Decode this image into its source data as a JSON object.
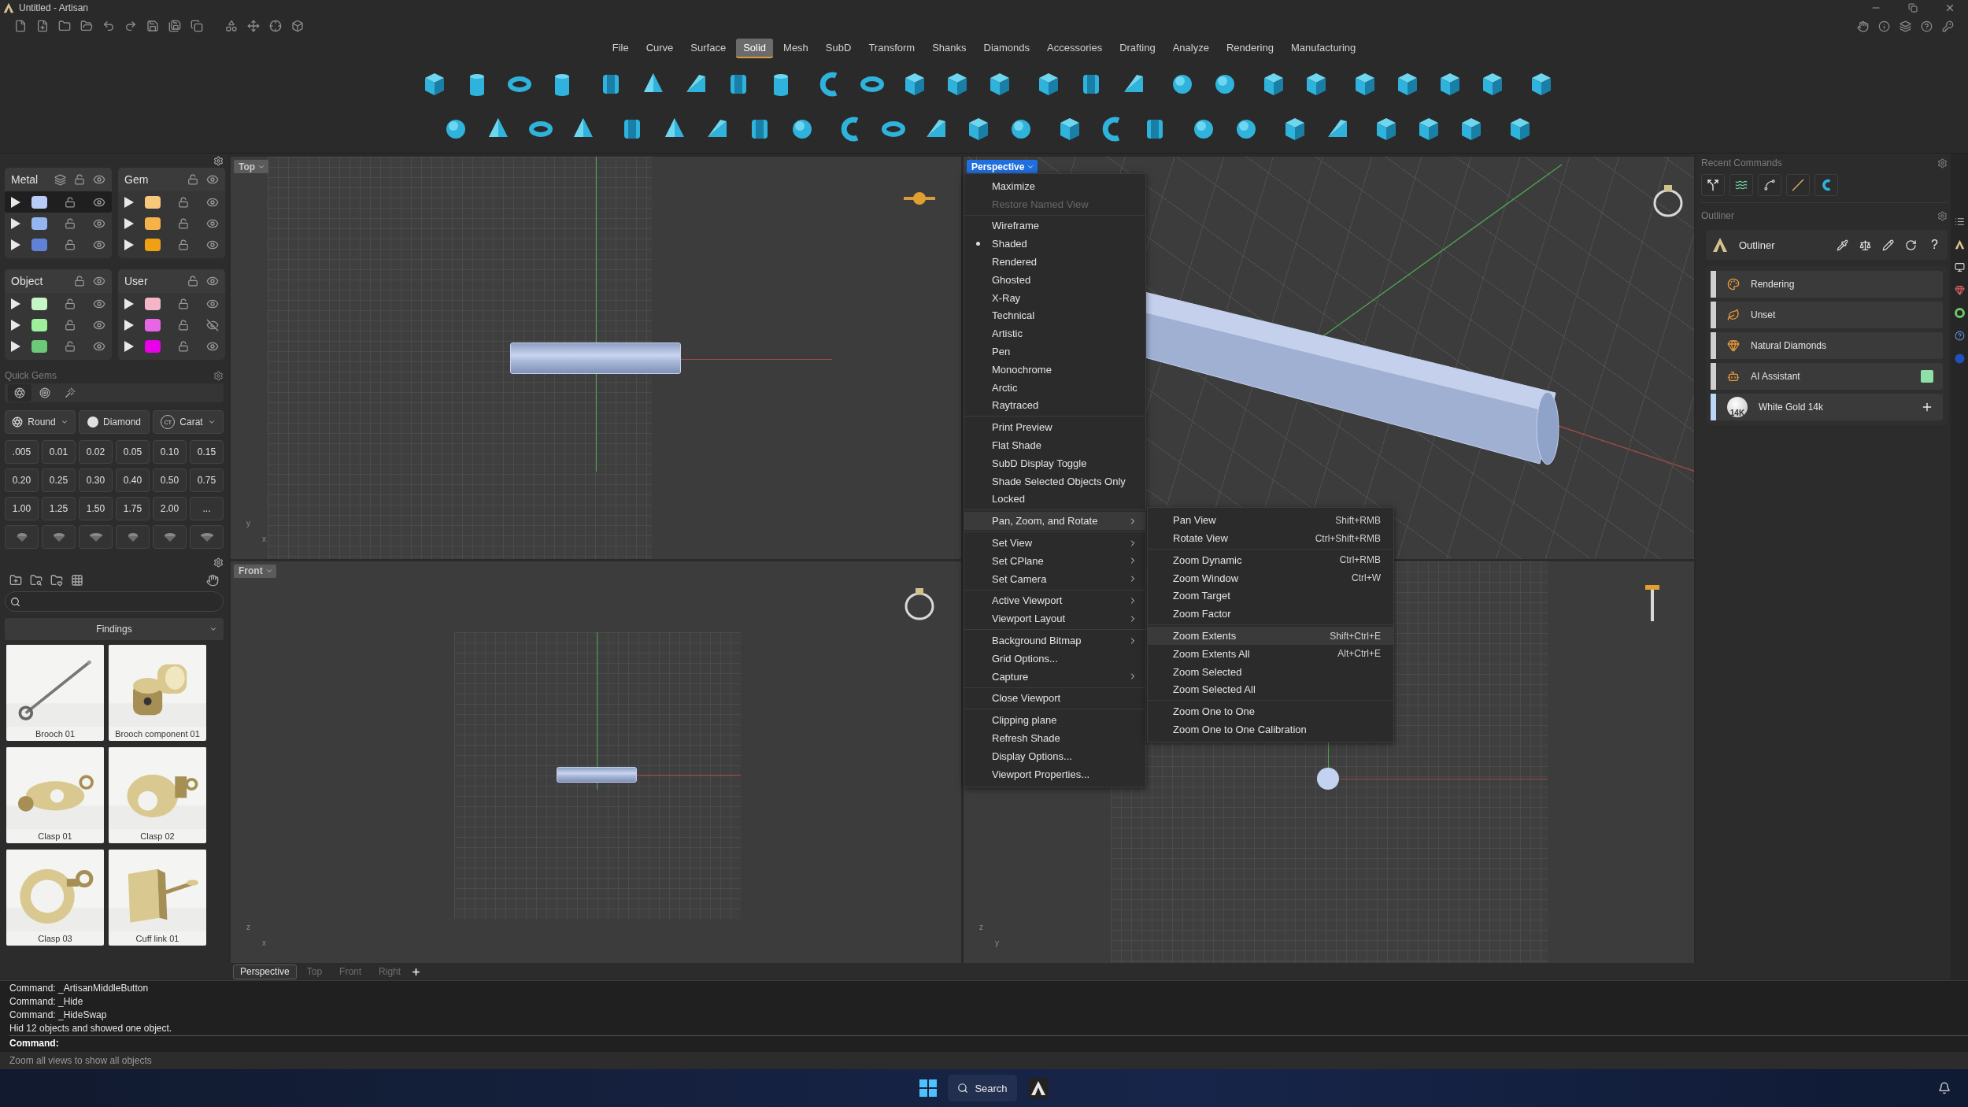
{
  "window": {
    "title": "Untitled - Artisan"
  },
  "menu_tabs": [
    {
      "label": "File",
      "selected": false
    },
    {
      "label": "Curve",
      "selected": false
    },
    {
      "label": "Surface",
      "selected": false
    },
    {
      "label": "Solid",
      "selected": true
    },
    {
      "label": "Mesh",
      "selected": false
    },
    {
      "label": "SubD",
      "selected": false
    },
    {
      "label": "Transform",
      "selected": false
    },
    {
      "label": "Shanks",
      "selected": false
    },
    {
      "label": "Diamonds",
      "selected": false
    },
    {
      "label": "Accessories",
      "selected": false
    },
    {
      "label": "Drafting",
      "selected": false
    },
    {
      "label": "Analyze",
      "selected": false
    },
    {
      "label": "Rendering",
      "selected": false
    },
    {
      "label": "Manufacturing",
      "selected": false
    }
  ],
  "layers": [
    {
      "name": "Metal",
      "material_toggle": true,
      "rows": [
        {
          "color": "#b9ccf7",
          "visible": true,
          "selected": true
        },
        {
          "color": "#94b6f0",
          "visible": true,
          "selected": false
        },
        {
          "color": "#5f82d6",
          "visible": true,
          "selected": false
        }
      ]
    },
    {
      "name": "Gem",
      "material_toggle": false,
      "rows": [
        {
          "color": "#f7c77a",
          "visible": true,
          "selected": false
        },
        {
          "color": "#f5b24a",
          "visible": true,
          "selected": false
        },
        {
          "color": "#f0a012",
          "visible": true,
          "selected": false
        }
      ]
    },
    {
      "name": "Object",
      "material_toggle": false,
      "rows": [
        {
          "color": "#c6f6c6",
          "visible": true,
          "selected": false
        },
        {
          "color": "#9ef09a",
          "visible": true,
          "selected": false
        },
        {
          "color": "#6cc978",
          "visible": true,
          "selected": false
        }
      ]
    },
    {
      "name": "User",
      "material_toggle": false,
      "rows": [
        {
          "color": "#f4b5c6",
          "visible": true,
          "selected": false
        },
        {
          "color": "#e866e6",
          "visible": false,
          "selected": false
        },
        {
          "color": "#e800e8",
          "visible": true,
          "selected": false
        }
      ]
    }
  ],
  "quick_gems": {
    "title": "Quick Gems",
    "shape": "Round",
    "material": "Diamond",
    "unit": "Carat",
    "unit_badge": "CT",
    "sizes": [
      ".005",
      "0.01",
      "0.02",
      "0.05",
      "0.10",
      "0.15",
      "0.20",
      "0.25",
      "0.30",
      "0.40",
      "0.50",
      "0.75",
      "1.00",
      "1.25",
      "1.50",
      "1.75",
      "2.00",
      "..."
    ]
  },
  "library": {
    "category": "Findings",
    "items": [
      {
        "label": "Brooch 01"
      },
      {
        "label": "Brooch component 01"
      },
      {
        "label": "Clasp 01"
      },
      {
        "label": "Clasp 02"
      },
      {
        "label": "Clasp 03"
      },
      {
        "label": "Cuff link 01"
      }
    ]
  },
  "viewports": {
    "top": {
      "label": "Top",
      "active": false,
      "axes": [
        "y",
        "x"
      ]
    },
    "perspective": {
      "label": "Perspective",
      "active": true
    },
    "front": {
      "label": "Front",
      "active": false,
      "axes": [
        "z",
        "x"
      ]
    },
    "right": {
      "axes": [
        "z",
        "y"
      ]
    }
  },
  "viewport_tabs": [
    {
      "label": "Perspective",
      "selected": true
    },
    {
      "label": "Top",
      "selected": false
    },
    {
      "label": "Front",
      "selected": false
    },
    {
      "label": "Right",
      "selected": false
    }
  ],
  "context_menu": {
    "sections": [
      [
        {
          "label": "Maximize",
          "disabled": false,
          "checked": false,
          "submenu": false,
          "selected": false
        },
        {
          "label": "Restore Named View",
          "disabled": true,
          "checked": false,
          "submenu": false,
          "selected": false
        }
      ],
      [
        {
          "label": "Wireframe",
          "disabled": false,
          "checked": false,
          "submenu": false,
          "selected": false
        },
        {
          "label": "Shaded",
          "disabled": false,
          "checked": true,
          "submenu": false,
          "selected": false
        },
        {
          "label": "Rendered",
          "disabled": false,
          "checked": false,
          "submenu": false,
          "selected": false
        },
        {
          "label": "Ghosted",
          "disabled": false,
          "checked": false,
          "submenu": false,
          "selected": false
        },
        {
          "label": "X-Ray",
          "disabled": false,
          "checked": false,
          "submenu": false,
          "selected": false
        },
        {
          "label": "Technical",
          "disabled": false,
          "checked": false,
          "submenu": false,
          "selected": false
        },
        {
          "label": "Artistic",
          "disabled": false,
          "checked": false,
          "submenu": false,
          "selected": false
        },
        {
          "label": "Pen",
          "disabled": false,
          "checked": false,
          "submenu": false,
          "selected": false
        },
        {
          "label": "Monochrome",
          "disabled": false,
          "checked": false,
          "submenu": false,
          "selected": false
        },
        {
          "label": "Arctic",
          "disabled": false,
          "checked": false,
          "submenu": false,
          "selected": false
        },
        {
          "label": "Raytraced",
          "disabled": false,
          "checked": false,
          "submenu": false,
          "selected": false
        }
      ],
      [
        {
          "label": "Print Preview",
          "disabled": false,
          "checked": false,
          "submenu": false,
          "selected": false
        },
        {
          "label": "Flat Shade",
          "disabled": false,
          "checked": false,
          "submenu": false,
          "selected": false
        },
        {
          "label": "SubD Display Toggle",
          "disabled": false,
          "checked": false,
          "submenu": false,
          "selected": false
        },
        {
          "label": "Shade Selected Objects Only",
          "disabled": false,
          "checked": false,
          "submenu": false,
          "selected": false
        },
        {
          "label": "Locked",
          "disabled": false,
          "checked": false,
          "submenu": false,
          "selected": false
        }
      ],
      [
        {
          "label": "Pan, Zoom, and Rotate",
          "disabled": false,
          "checked": false,
          "submenu": true,
          "selected": true
        }
      ],
      [
        {
          "label": "Set View",
          "disabled": false,
          "checked": false,
          "submenu": true,
          "selected": false
        },
        {
          "label": "Set CPlane",
          "disabled": false,
          "checked": false,
          "submenu": true,
          "selected": false
        },
        {
          "label": "Set Camera",
          "disabled": false,
          "checked": false,
          "submenu": true,
          "selected": false
        }
      ],
      [
        {
          "label": "Active Viewport",
          "disabled": false,
          "checked": false,
          "submenu": true,
          "selected": false
        },
        {
          "label": "Viewport Layout",
          "disabled": false,
          "checked": false,
          "submenu": true,
          "selected": false
        }
      ],
      [
        {
          "label": "Background Bitmap",
          "disabled": false,
          "checked": false,
          "submenu": true,
          "selected": false
        },
        {
          "label": "Grid Options...",
          "disabled": false,
          "checked": false,
          "submenu": false,
          "selected": false
        },
        {
          "label": "Capture",
          "disabled": false,
          "checked": false,
          "submenu": true,
          "selected": false
        }
      ],
      [
        {
          "label": "Close Viewport",
          "disabled": false,
          "checked": false,
          "submenu": false,
          "selected": false
        }
      ],
      [
        {
          "label": "Clipping plane",
          "disabled": false,
          "checked": false,
          "submenu": false,
          "selected": false
        },
        {
          "label": "Refresh Shade",
          "disabled": false,
          "checked": false,
          "submenu": false,
          "selected": false
        },
        {
          "label": "Display Options...",
          "disabled": false,
          "checked": false,
          "submenu": false,
          "selected": false
        },
        {
          "label": "Viewport Properties...",
          "disabled": false,
          "checked": false,
          "submenu": false,
          "selected": false
        }
      ]
    ]
  },
  "submenu": {
    "sections": [
      [
        {
          "label": "Pan View",
          "shortcut": "Shift+RMB",
          "selected": false
        },
        {
          "label": "Rotate View",
          "shortcut": "Ctrl+Shift+RMB",
          "selected": false
        }
      ],
      [
        {
          "label": "Zoom Dynamic",
          "shortcut": "Ctrl+RMB",
          "selected": false
        },
        {
          "label": "Zoom Window",
          "shortcut": "Ctrl+W",
          "selected": false
        },
        {
          "label": "Zoom Target",
          "selected": false
        },
        {
          "label": "Zoom Factor",
          "selected": false
        }
      ],
      [
        {
          "label": "Zoom Extents",
          "shortcut": "Shift+Ctrl+E",
          "selected": true
        },
        {
          "label": "Zoom Extents All",
          "shortcut": "Alt+Ctrl+E",
          "selected": false
        },
        {
          "label": "Zoom Selected",
          "selected": false
        },
        {
          "label": "Zoom Selected All",
          "selected": false
        }
      ],
      [
        {
          "label": "Zoom One to One",
          "selected": false
        },
        {
          "label": "Zoom One to One Calibration",
          "selected": false
        }
      ]
    ]
  },
  "recent_commands": {
    "title": "Recent Commands"
  },
  "outliner": {
    "panel_title": "Outliner",
    "title": "Outliner",
    "help": "?",
    "items": [
      {
        "label": "Rendering",
        "kind": "plain",
        "selected": false
      },
      {
        "label": "Unset",
        "kind": "plain",
        "selected": false
      },
      {
        "label": "Natural Diamonds",
        "kind": "plain",
        "selected": false
      },
      {
        "label": "AI Assistant",
        "kind": "swatch",
        "selected": false
      },
      {
        "label": "White Gold 14k",
        "kind": "add",
        "selected": true,
        "badge": "14K"
      }
    ]
  },
  "command_history": [
    "Command: _ArtisanMiddleButton",
    "Command: _Hide",
    "Command: _HideSwap",
    "Hid 12 objects and showed one object."
  ],
  "command_prompt": "Command:",
  "status": "Zoom all views to show all objects",
  "taskbar": {
    "search": "Search"
  }
}
